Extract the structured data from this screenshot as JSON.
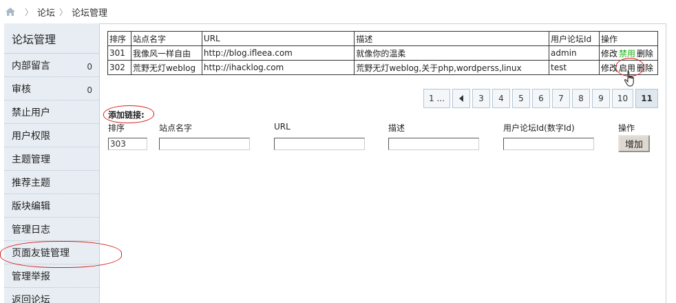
{
  "breadcrumb": {
    "items": [
      "论坛",
      "论坛管理"
    ]
  },
  "sidebar": {
    "title": "论坛管理",
    "items": [
      {
        "label": "内部留言",
        "count": "0"
      },
      {
        "label": "审核",
        "count": "0"
      },
      {
        "label": "禁止用户"
      },
      {
        "label": "用户权限"
      },
      {
        "label": "主题管理"
      },
      {
        "label": "推荐主题"
      },
      {
        "label": "版块编辑"
      },
      {
        "label": "管理日志"
      },
      {
        "label": "页面友链管理"
      },
      {
        "label": "管理举报"
      },
      {
        "label": "返回论坛"
      }
    ]
  },
  "table": {
    "headers": [
      "排序",
      "站点名字",
      "URL",
      "描述",
      "用户论坛Id",
      "操作"
    ],
    "rows": [
      {
        "order": "301",
        "name": "我像风一样自由",
        "url": "http://blog.ifleea.com",
        "desc": "就像你的温柔",
        "uid": "admin",
        "edit": "修改",
        "toggle": "禁用",
        "del": "删除"
      },
      {
        "order": "302",
        "name": "荒野无灯weblog",
        "url": "http://ihacklog.com",
        "desc": "荒野无灯weblog,关于php,wordperss,linux",
        "uid": "test",
        "edit": "修改",
        "toggle": "启用",
        "del": "删除"
      }
    ]
  },
  "pagination": {
    "first": "1 ...",
    "pages": [
      "3",
      "4",
      "5",
      "6",
      "7",
      "8",
      "9",
      "10"
    ],
    "current": "11"
  },
  "add_form": {
    "title": "添加链接:",
    "labels": {
      "order": "排序",
      "name": "站点名字",
      "url": "URL",
      "desc": "描述",
      "uid": "用户论坛Id(数字Id)",
      "op": "操作"
    },
    "order_value": "303",
    "button": "增加"
  },
  "colors": {
    "sidebar_bg": "#e7edf3",
    "disable_link": "#1bb21b",
    "annotation": "#d81c1c"
  }
}
